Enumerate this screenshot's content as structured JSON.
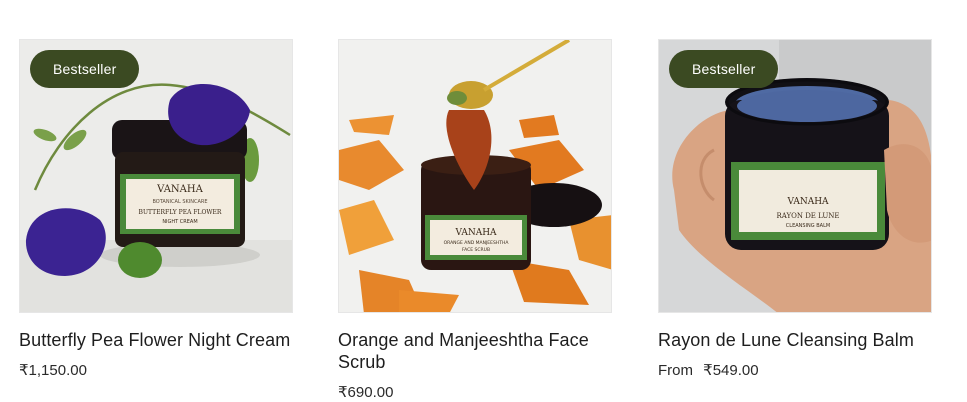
{
  "colors": {
    "badge_bg": "#3b4a22",
    "text": "#1e1e1e"
  },
  "products": [
    {
      "title": "Butterfly Pea Flower Night Cream",
      "badge": "Bestseller",
      "price_prefix": "",
      "price": "₹1,150.00",
      "image_label": {
        "brand": "VANAHA",
        "line1": "BOTANICAL SKINCARE",
        "line2": "BUTTERFLY PEA FLOWER",
        "line3": "NIGHT CREAM"
      }
    },
    {
      "title": "Orange and Manjeeshtha Face Scrub",
      "badge": "",
      "price_prefix": "",
      "price": "₹690.00",
      "image_label": {
        "brand": "VANAHA",
        "line1": "ORANGE AND MANJEESHTHA",
        "line2": "FACE SCRUB"
      }
    },
    {
      "title": "Rayon de Lune Cleansing Balm",
      "badge": "Bestseller",
      "price_prefix": "From",
      "price": "₹549.00",
      "image_label": {
        "brand": "VANAHA",
        "line1": "RAYON DE LUNE",
        "line2": "CLEANSING BALM"
      }
    }
  ]
}
